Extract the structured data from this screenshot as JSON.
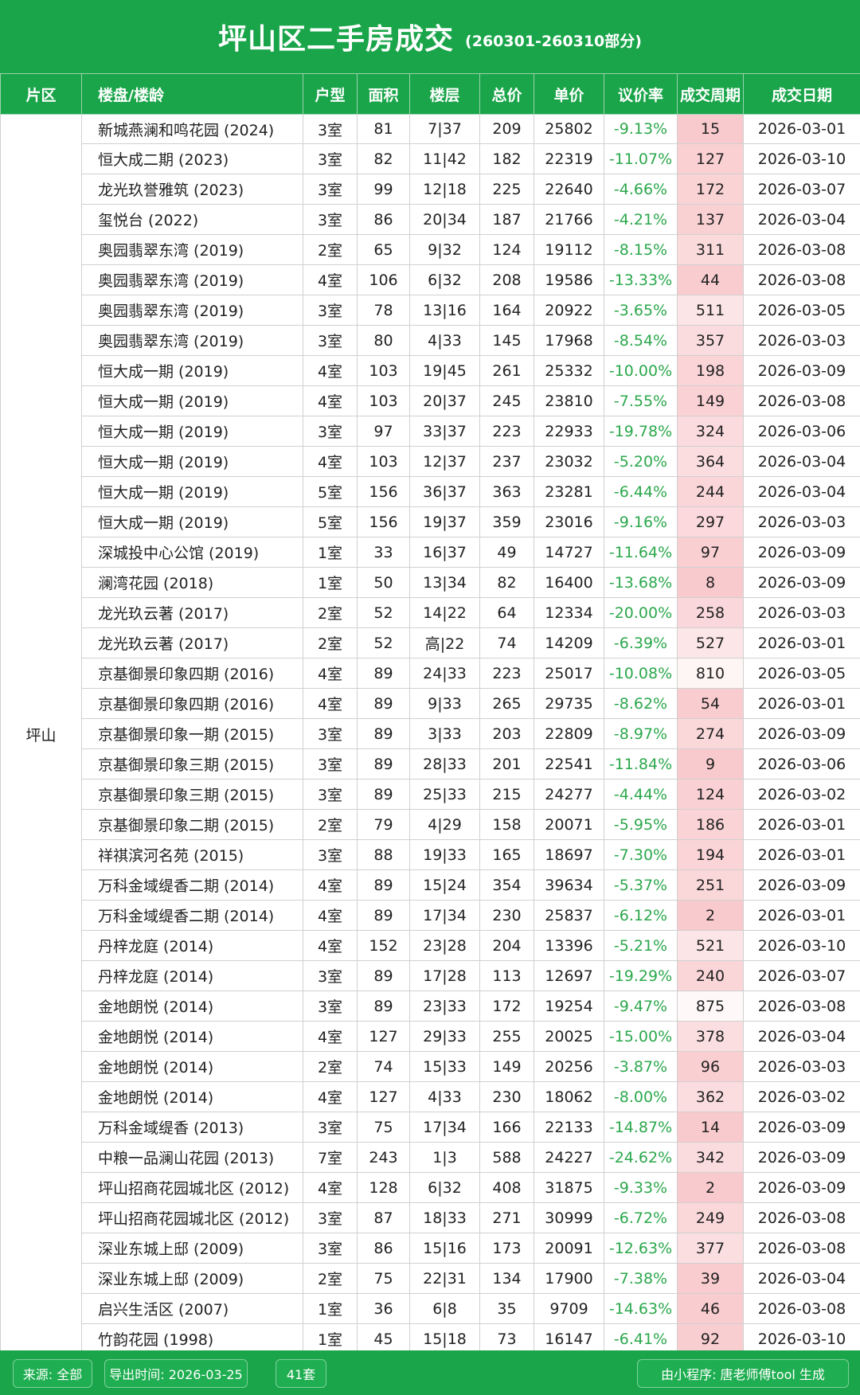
{
  "header": {
    "title": "坪山区二手房成交",
    "subtitle": "(260301-260310部分)"
  },
  "columns": [
    "片区",
    "楼盘/楼龄",
    "户型",
    "面积",
    "楼层",
    "总价",
    "单价",
    "议价率",
    "成交周期",
    "成交日期"
  ],
  "area": "坪山",
  "rows": [
    {
      "name": "新城燕澜和鸣花园 (2024)",
      "type": "3室",
      "size": "81",
      "floor": "7|37",
      "total": "209",
      "unit": "25802",
      "rate": "-9.13%",
      "cycle": "15",
      "date": "2026-03-01"
    },
    {
      "name": "恒大成二期 (2023)",
      "type": "3室",
      "size": "82",
      "floor": "11|42",
      "total": "182",
      "unit": "22319",
      "rate": "-11.07%",
      "cycle": "127",
      "date": "2026-03-10"
    },
    {
      "name": "龙光玖誉雅筑 (2023)",
      "type": "3室",
      "size": "99",
      "floor": "12|18",
      "total": "225",
      "unit": "22640",
      "rate": "-4.66%",
      "cycle": "172",
      "date": "2026-03-07"
    },
    {
      "name": "玺悦台 (2022)",
      "type": "3室",
      "size": "86",
      "floor": "20|34",
      "total": "187",
      "unit": "21766",
      "rate": "-4.21%",
      "cycle": "137",
      "date": "2026-03-04"
    },
    {
      "name": "奥园翡翠东湾 (2019)",
      "type": "2室",
      "size": "65",
      "floor": "9|32",
      "total": "124",
      "unit": "19112",
      "rate": "-8.15%",
      "cycle": "311",
      "date": "2026-03-08"
    },
    {
      "name": "奥园翡翠东湾 (2019)",
      "type": "4室",
      "size": "106",
      "floor": "6|32",
      "total": "208",
      "unit": "19586",
      "rate": "-13.33%",
      "cycle": "44",
      "date": "2026-03-08"
    },
    {
      "name": "奥园翡翠东湾 (2019)",
      "type": "3室",
      "size": "78",
      "floor": "13|16",
      "total": "164",
      "unit": "20922",
      "rate": "-3.65%",
      "cycle": "511",
      "date": "2026-03-05"
    },
    {
      "name": "奥园翡翠东湾 (2019)",
      "type": "3室",
      "size": "80",
      "floor": "4|33",
      "total": "145",
      "unit": "17968",
      "rate": "-8.54%",
      "cycle": "357",
      "date": "2026-03-03"
    },
    {
      "name": "恒大成一期 (2019)",
      "type": "4室",
      "size": "103",
      "floor": "19|45",
      "total": "261",
      "unit": "25332",
      "rate": "-10.00%",
      "cycle": "198",
      "date": "2026-03-09"
    },
    {
      "name": "恒大成一期 (2019)",
      "type": "4室",
      "size": "103",
      "floor": "20|37",
      "total": "245",
      "unit": "23810",
      "rate": "-7.55%",
      "cycle": "149",
      "date": "2026-03-08"
    },
    {
      "name": "恒大成一期 (2019)",
      "type": "3室",
      "size": "97",
      "floor": "33|37",
      "total": "223",
      "unit": "22933",
      "rate": "-19.78%",
      "cycle": "324",
      "date": "2026-03-06"
    },
    {
      "name": "恒大成一期 (2019)",
      "type": "4室",
      "size": "103",
      "floor": "12|37",
      "total": "237",
      "unit": "23032",
      "rate": "-5.20%",
      "cycle": "364",
      "date": "2026-03-04"
    },
    {
      "name": "恒大成一期 (2019)",
      "type": "5室",
      "size": "156",
      "floor": "36|37",
      "total": "363",
      "unit": "23281",
      "rate": "-6.44%",
      "cycle": "244",
      "date": "2026-03-04"
    },
    {
      "name": "恒大成一期 (2019)",
      "type": "5室",
      "size": "156",
      "floor": "19|37",
      "total": "359",
      "unit": "23016",
      "rate": "-9.16%",
      "cycle": "297",
      "date": "2026-03-03"
    },
    {
      "name": "深城投中心公馆 (2019)",
      "type": "1室",
      "size": "33",
      "floor": "16|37",
      "total": "49",
      "unit": "14727",
      "rate": "-11.64%",
      "cycle": "97",
      "date": "2026-03-09"
    },
    {
      "name": "澜湾花园 (2018)",
      "type": "1室",
      "size": "50",
      "floor": "13|34",
      "total": "82",
      "unit": "16400",
      "rate": "-13.68%",
      "cycle": "8",
      "date": "2026-03-09"
    },
    {
      "name": "龙光玖云著 (2017)",
      "type": "2室",
      "size": "52",
      "floor": "14|22",
      "total": "64",
      "unit": "12334",
      "rate": "-20.00%",
      "cycle": "258",
      "date": "2026-03-03"
    },
    {
      "name": "龙光玖云著 (2017)",
      "type": "2室",
      "size": "52",
      "floor": "高|22",
      "total": "74",
      "unit": "14209",
      "rate": "-6.39%",
      "cycle": "527",
      "date": "2026-03-01"
    },
    {
      "name": "京基御景印象四期 (2016)",
      "type": "4室",
      "size": "89",
      "floor": "24|33",
      "total": "223",
      "unit": "25017",
      "rate": "-10.08%",
      "cycle": "810",
      "date": "2026-03-05"
    },
    {
      "name": "京基御景印象四期 (2016)",
      "type": "4室",
      "size": "89",
      "floor": "9|33",
      "total": "265",
      "unit": "29735",
      "rate": "-8.62%",
      "cycle": "54",
      "date": "2026-03-01"
    },
    {
      "name": "京基御景印象一期 (2015)",
      "type": "3室",
      "size": "89",
      "floor": "3|33",
      "total": "203",
      "unit": "22809",
      "rate": "-8.97%",
      "cycle": "274",
      "date": "2026-03-09"
    },
    {
      "name": "京基御景印象三期 (2015)",
      "type": "3室",
      "size": "89",
      "floor": "28|33",
      "total": "201",
      "unit": "22541",
      "rate": "-11.84%",
      "cycle": "9",
      "date": "2026-03-06"
    },
    {
      "name": "京基御景印象三期 (2015)",
      "type": "3室",
      "size": "89",
      "floor": "25|33",
      "total": "215",
      "unit": "24277",
      "rate": "-4.44%",
      "cycle": "124",
      "date": "2026-03-02"
    },
    {
      "name": "京基御景印象二期 (2015)",
      "type": "2室",
      "size": "79",
      "floor": "4|29",
      "total": "158",
      "unit": "20071",
      "rate": "-5.95%",
      "cycle": "186",
      "date": "2026-03-01"
    },
    {
      "name": "祥祺滨河名苑 (2015)",
      "type": "3室",
      "size": "88",
      "floor": "19|33",
      "total": "165",
      "unit": "18697",
      "rate": "-7.30%",
      "cycle": "194",
      "date": "2026-03-01"
    },
    {
      "name": "万科金域缇香二期 (2014)",
      "type": "4室",
      "size": "89",
      "floor": "15|24",
      "total": "354",
      "unit": "39634",
      "rate": "-5.37%",
      "cycle": "251",
      "date": "2026-03-09"
    },
    {
      "name": "万科金域缇香二期 (2014)",
      "type": "4室",
      "size": "89",
      "floor": "17|34",
      "total": "230",
      "unit": "25837",
      "rate": "-6.12%",
      "cycle": "2",
      "date": "2026-03-01"
    },
    {
      "name": "丹梓龙庭 (2014)",
      "type": "4室",
      "size": "152",
      "floor": "23|28",
      "total": "204",
      "unit": "13396",
      "rate": "-5.21%",
      "cycle": "521",
      "date": "2026-03-10"
    },
    {
      "name": "丹梓龙庭 (2014)",
      "type": "3室",
      "size": "89",
      "floor": "17|28",
      "total": "113",
      "unit": "12697",
      "rate": "-19.29%",
      "cycle": "240",
      "date": "2026-03-07"
    },
    {
      "name": "金地朗悦 (2014)",
      "type": "3室",
      "size": "89",
      "floor": "23|33",
      "total": "172",
      "unit": "19254",
      "rate": "-9.47%",
      "cycle": "875",
      "date": "2026-03-08"
    },
    {
      "name": "金地朗悦 (2014)",
      "type": "4室",
      "size": "127",
      "floor": "29|33",
      "total": "255",
      "unit": "20025",
      "rate": "-15.00%",
      "cycle": "378",
      "date": "2026-03-04"
    },
    {
      "name": "金地朗悦 (2014)",
      "type": "2室",
      "size": "74",
      "floor": "15|33",
      "total": "149",
      "unit": "20256",
      "rate": "-3.87%",
      "cycle": "96",
      "date": "2026-03-03"
    },
    {
      "name": "金地朗悦 (2014)",
      "type": "4室",
      "size": "127",
      "floor": "4|33",
      "total": "230",
      "unit": "18062",
      "rate": "-8.00%",
      "cycle": "362",
      "date": "2026-03-02"
    },
    {
      "name": "万科金域缇香 (2013)",
      "type": "3室",
      "size": "75",
      "floor": "17|34",
      "total": "166",
      "unit": "22133",
      "rate": "-14.87%",
      "cycle": "14",
      "date": "2026-03-09"
    },
    {
      "name": "中粮一品澜山花园 (2013)",
      "type": "7室",
      "size": "243",
      "floor": "1|3",
      "total": "588",
      "unit": "24227",
      "rate": "-24.62%",
      "cycle": "342",
      "date": "2026-03-09"
    },
    {
      "name": "坪山招商花园城北区 (2012)",
      "type": "4室",
      "size": "128",
      "floor": "6|32",
      "total": "408",
      "unit": "31875",
      "rate": "-9.33%",
      "cycle": "2",
      "date": "2026-03-09"
    },
    {
      "name": "坪山招商花园城北区 (2012)",
      "type": "3室",
      "size": "87",
      "floor": "18|33",
      "total": "271",
      "unit": "30999",
      "rate": "-6.72%",
      "cycle": "249",
      "date": "2026-03-08"
    },
    {
      "name": "深业东城上邸 (2009)",
      "type": "3室",
      "size": "86",
      "floor": "15|16",
      "total": "173",
      "unit": "20091",
      "rate": "-12.63%",
      "cycle": "377",
      "date": "2026-03-08"
    },
    {
      "name": "深业东城上邸 (2009)",
      "type": "2室",
      "size": "75",
      "floor": "22|31",
      "total": "134",
      "unit": "17900",
      "rate": "-7.38%",
      "cycle": "39",
      "date": "2026-03-04"
    },
    {
      "name": "启兴生活区 (2007)",
      "type": "1室",
      "size": "36",
      "floor": "6|8",
      "total": "35",
      "unit": "9709",
      "rate": "-14.63%",
      "cycle": "46",
      "date": "2026-03-08"
    },
    {
      "name": "竹韵花园 (1998)",
      "type": "1室",
      "size": "45",
      "floor": "15|18",
      "total": "73",
      "unit": "16147",
      "rate": "-6.41%",
      "cycle": "92",
      "date": "2026-03-10"
    }
  ],
  "footer": {
    "source": "来源: 全部",
    "export_time": "导出时间: 2026-03-25",
    "count": "41套",
    "credit": "由小程序: 唐老师傅tool 生成"
  },
  "colors": {
    "brand_green": "#1aa54a",
    "rate_green": "#2ca84c",
    "cycle_pink_max": "#fcdede"
  }
}
